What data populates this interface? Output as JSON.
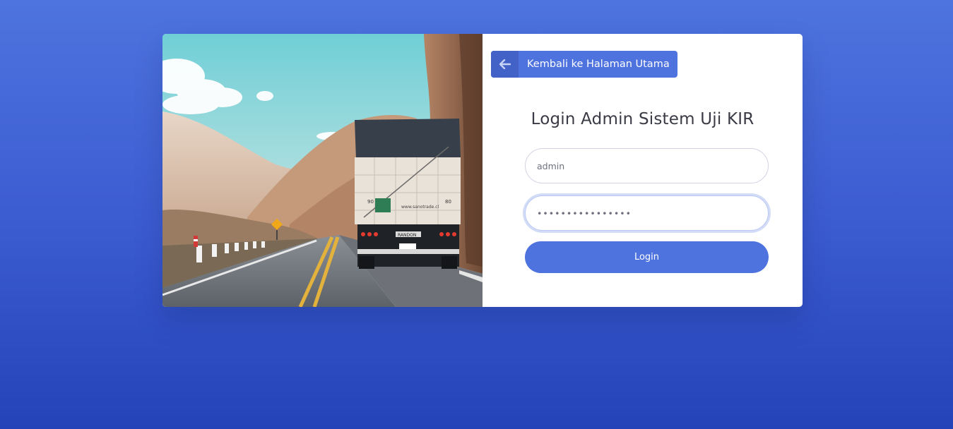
{
  "back_button": {
    "label": "Kembali ke Halaman Utama",
    "icon": "arrow-left-icon"
  },
  "login": {
    "title": "Login Admin Sistem Uji KIR",
    "username_value": "admin",
    "password_value": "••••••••••••••••",
    "submit_label": "Login"
  },
  "hero_image": {
    "subject": "truck-on-mountain-road",
    "truck_text": {
      "website": "www.sanotrade.cl",
      "brand": "RANDON",
      "left_number": "90",
      "right_number": "80"
    }
  },
  "colors": {
    "primary": "#4e73df",
    "primary_dark": "#4262c7",
    "background_top": "#4e74df",
    "background_bottom": "#2443b9",
    "title_text": "#3a3b45"
  }
}
